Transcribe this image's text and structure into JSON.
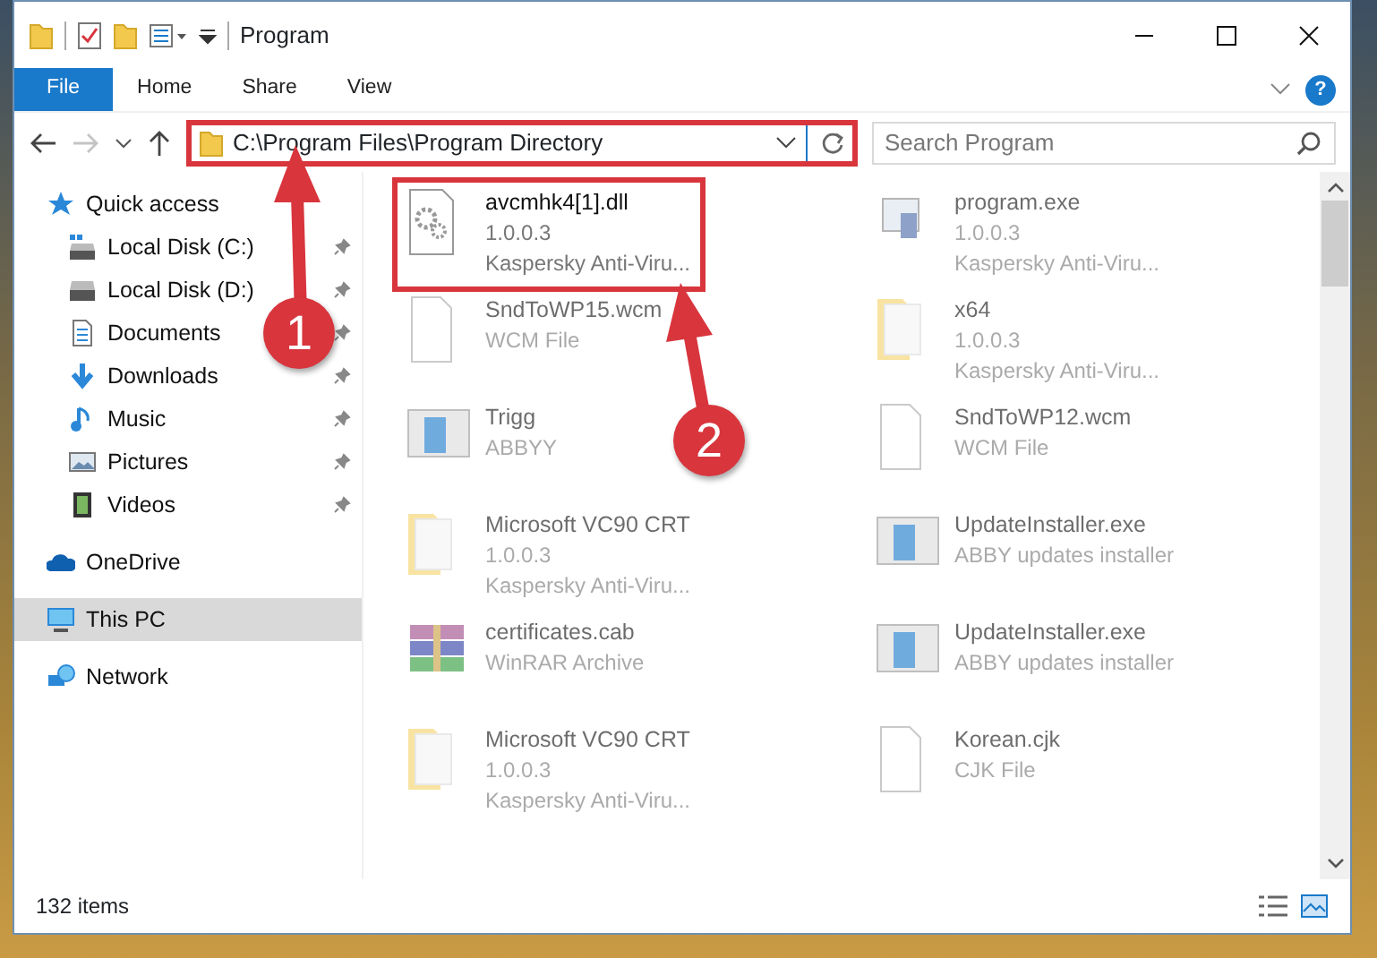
{
  "window": {
    "title": "Program"
  },
  "ribbon": {
    "tabs": [
      {
        "label": "File",
        "selected": true
      },
      {
        "label": "Home",
        "selected": false
      },
      {
        "label": "Share",
        "selected": false
      },
      {
        "label": "View",
        "selected": false
      }
    ],
    "help": "?"
  },
  "address_bar": {
    "path": "C:\\Program Files\\Program Directory",
    "highlighted": true
  },
  "search": {
    "placeholder": "Search Program"
  },
  "sidebar": {
    "items": [
      {
        "label": "Quick access",
        "kind": "quick",
        "pinned": false,
        "selected": false
      },
      {
        "label": "Local Disk (C:)",
        "kind": "disk-c",
        "pinned": true,
        "selected": false
      },
      {
        "label": "Local Disk (D:)",
        "kind": "disk",
        "pinned": true,
        "selected": false
      },
      {
        "label": "Documents",
        "kind": "documents",
        "pinned": true,
        "selected": false
      },
      {
        "label": "Downloads",
        "kind": "downloads",
        "pinned": true,
        "selected": false
      },
      {
        "label": "Music",
        "kind": "music",
        "pinned": true,
        "selected": false
      },
      {
        "label": "Pictures",
        "kind": "pictures",
        "pinned": true,
        "selected": false
      },
      {
        "label": "Videos",
        "kind": "videos",
        "pinned": true,
        "selected": false
      },
      {
        "label": "OneDrive",
        "kind": "onedrive",
        "pinned": false,
        "selected": false
      },
      {
        "label": "This PC",
        "kind": "pc",
        "pinned": false,
        "selected": true
      },
      {
        "label": "Network",
        "kind": "network",
        "pinned": false,
        "selected": false
      }
    ]
  },
  "files": [
    {
      "name": "avcmhk4[1].dll",
      "details": [
        "1.0.0.3",
        "Kaspersky Anti-Viru..."
      ],
      "kind": "dll",
      "highlighted": true,
      "dimmed": false
    },
    {
      "name": "program.exe",
      "details": [
        "1.0.0.3",
        "Kaspersky Anti-Viru..."
      ],
      "kind": "exe",
      "highlighted": false,
      "dimmed": true
    },
    {
      "name": "SndToWP15.wcm",
      "details": [
        "WCM File"
      ],
      "kind": "file",
      "highlighted": false,
      "dimmed": true
    },
    {
      "name": "x64",
      "details": [
        "1.0.0.3",
        "Kaspersky Anti-Viru..."
      ],
      "kind": "folder",
      "highlighted": false,
      "dimmed": true
    },
    {
      "name": "Trigg",
      "details": [
        "ABBYY"
      ],
      "kind": "installer",
      "highlighted": false,
      "dimmed": true
    },
    {
      "name": "SndToWP12.wcm",
      "details": [
        "WCM File"
      ],
      "kind": "file",
      "highlighted": false,
      "dimmed": true
    },
    {
      "name": "Microsoft VC90 CRT",
      "details": [
        "1.0.0.3",
        "Kaspersky Anti-Viru..."
      ],
      "kind": "folder",
      "highlighted": false,
      "dimmed": true
    },
    {
      "name": "UpdateInstaller.exe",
      "details": [
        "ABBY updates installer"
      ],
      "kind": "installer",
      "highlighted": false,
      "dimmed": true
    },
    {
      "name": "certificates.cab",
      "details": [
        "WinRAR Archive"
      ],
      "kind": "archive",
      "highlighted": false,
      "dimmed": true
    },
    {
      "name": "UpdateInstaller.exe",
      "details": [
        "ABBY updates installer"
      ],
      "kind": "installer",
      "highlighted": false,
      "dimmed": true
    },
    {
      "name": "Microsoft VC90 CRT",
      "details": [
        "1.0.0.3",
        "Kaspersky Anti-Viru..."
      ],
      "kind": "folder",
      "highlighted": false,
      "dimmed": true
    },
    {
      "name": "Korean.cjk",
      "details": [
        "CJK File"
      ],
      "kind": "file",
      "highlighted": false,
      "dimmed": true
    }
  ],
  "annotations": [
    {
      "number": "1"
    },
    {
      "number": "2"
    }
  ],
  "status_bar": {
    "count": "132 items"
  }
}
